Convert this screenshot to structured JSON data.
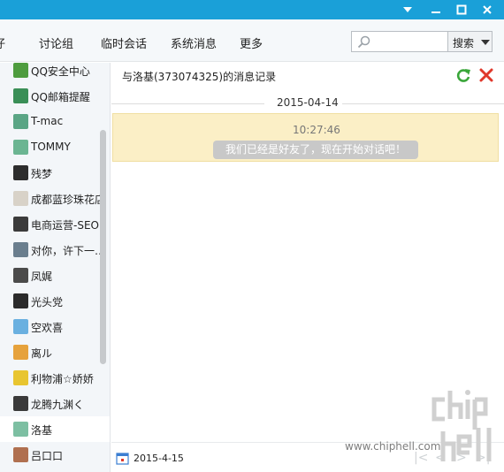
{
  "window": {
    "controls": [
      "dropdown-icon",
      "minimize-icon",
      "maximize-icon",
      "close-icon"
    ],
    "accent": "#1aa0d8"
  },
  "toolbar": {
    "tabs": [
      "仔",
      "讨论组",
      "临时会话",
      "系统消息",
      "更多"
    ],
    "search_placeholder": "",
    "search_button": "搜索"
  },
  "contacts": [
    {
      "name": "QQ安全中心",
      "avatar_color": "#4e9c3e"
    },
    {
      "name": "QQ邮箱提醒",
      "avatar_color": "#3a8f57"
    },
    {
      "name": "T-mac",
      "avatar_color": "#5aa585"
    },
    {
      "name": "TOMMY",
      "avatar_color": "#6bb592"
    },
    {
      "name": "残梦",
      "avatar_color": "#2d2d2d"
    },
    {
      "name": "成都蓝珍珠花店",
      "avatar_color": "#d8d2c8"
    },
    {
      "name": "电商运营-SEO…",
      "avatar_color": "#3b3b3b"
    },
    {
      "name": "对你，许下一…",
      "avatar_color": "#6a7e8e"
    },
    {
      "name": "凤娓",
      "avatar_color": "#4b4b4b"
    },
    {
      "name": "光头党",
      "avatar_color": "#2b2b2b"
    },
    {
      "name": "空欢喜",
      "avatar_color": "#6ab0e0"
    },
    {
      "name": "离ル",
      "avatar_color": "#e6a23c"
    },
    {
      "name": "利物浦☆娇娇",
      "avatar_color": "#e8c530"
    },
    {
      "name": "龙腾九渊く",
      "avatar_color": "#3a3a3a"
    },
    {
      "name": "洛基",
      "avatar_color": "#7dbfa2",
      "selected": true
    },
    {
      "name": "吕口口",
      "avatar_color": "#b07050"
    }
  ],
  "conversation": {
    "title": "与洛基(373074325)的消息记录",
    "refresh_icon": "refresh-icon",
    "close_icon": "close-red-icon",
    "date_separator": "2015-04-14",
    "system_message": {
      "time": "10:27:46",
      "text": "我们已经是好友了，现在开始对话吧！"
    }
  },
  "footer": {
    "calendar_icon": "calendar-icon",
    "date": "2015-4-15",
    "nav": [
      "first-page-icon",
      "prev-page-icon",
      "next-page-icon",
      "last-page-icon"
    ]
  },
  "watermark": {
    "url": "www.chiphell.com",
    "logo_text": "chip hell"
  }
}
